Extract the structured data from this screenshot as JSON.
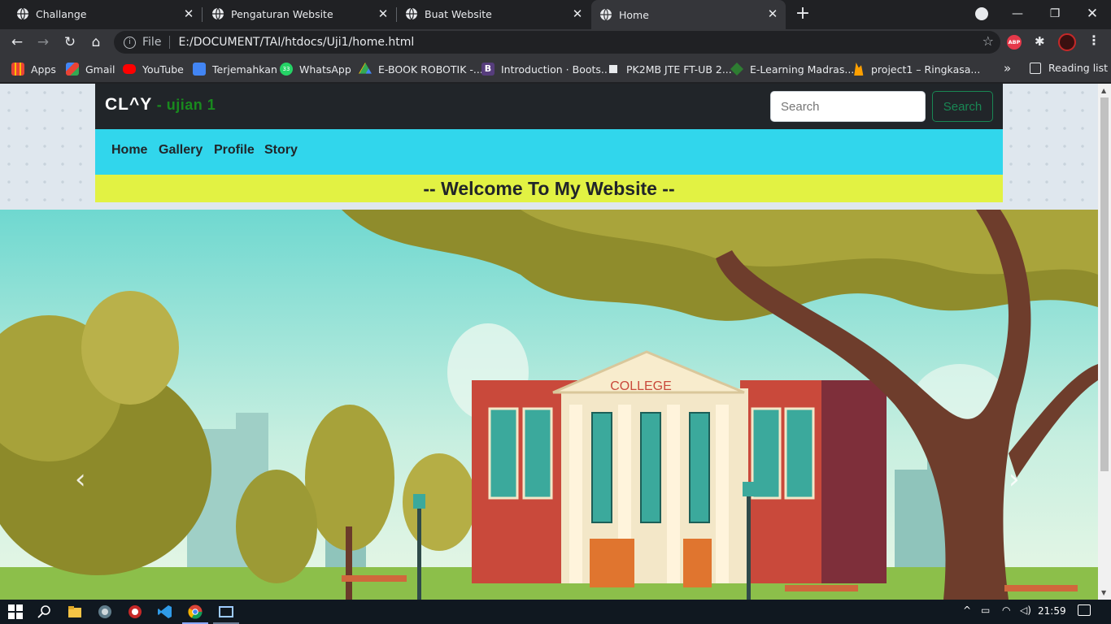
{
  "browser": {
    "tabs": [
      {
        "title": "Challange",
        "active": false
      },
      {
        "title": "Pengaturan Website",
        "active": false
      },
      {
        "title": "Buat Website",
        "active": false
      },
      {
        "title": "Home",
        "active": true
      }
    ],
    "address": {
      "scheme_label": "File",
      "url": "E:/DOCUMENT/TAI/htdocs/Uji1/home.html"
    },
    "bookmarks": [
      {
        "label": "Apps",
        "icon": "apps-grid-icon"
      },
      {
        "label": "Gmail",
        "icon": "gmail-icon"
      },
      {
        "label": "YouTube",
        "icon": "youtube-icon"
      },
      {
        "label": "Terjemahkan",
        "icon": "translate-icon"
      },
      {
        "label": "WhatsApp",
        "icon": "whatsapp-icon"
      },
      {
        "label": "E-BOOK ROBOTIK -...",
        "icon": "drive-icon"
      },
      {
        "label": "Introduction · Boots...",
        "icon": "bootstrap-icon"
      },
      {
        "label": "PK2MB JTE FT-UB 2...",
        "icon": "site-icon"
      },
      {
        "label": "E-Learning Madras...",
        "icon": "madrasah-icon"
      },
      {
        "label": "project1 – Ringkasa...",
        "icon": "firebase-icon"
      }
    ],
    "more_label": "»",
    "reading_list": "Reading list",
    "abp_label": "ABP",
    "whatsapp_badge": "33"
  },
  "site": {
    "brand": "CL^Y",
    "brand_sub": " - ujian 1",
    "search": {
      "placeholder": "Search",
      "button_label": "Search"
    },
    "nav": [
      "Home",
      "Gallery",
      "Profile",
      "Story"
    ],
    "welcome": "-- Welcome To My Website --",
    "carousel": {
      "building_sign": "COLLEGE"
    }
  },
  "taskbar": {
    "time": "21:59"
  },
  "colors": {
    "header_bg": "#212529",
    "nav_bg": "#31d6ec",
    "welcome_bg": "#e2f243",
    "brand_accent": "#198a1e",
    "search_btn": "#198754"
  }
}
